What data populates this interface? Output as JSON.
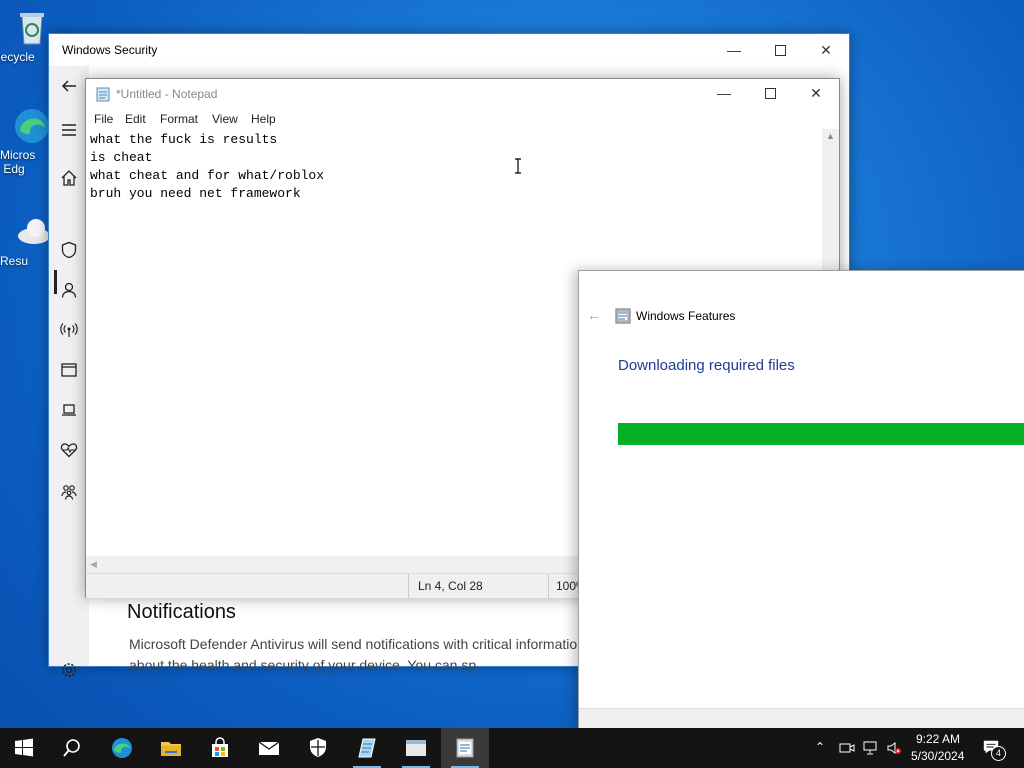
{
  "desktop": {
    "icons": [
      {
        "label": "Recycle",
        "icon": "recycle-bin-icon"
      },
      {
        "label": "Micros\nEdg",
        "icon": "edge-icon"
      },
      {
        "label": "Resu",
        "icon": "cloud-icon"
      }
    ]
  },
  "security_window": {
    "title": "Windows Security",
    "notifications_heading": "Notifications",
    "notifications_text": "Microsoft Defender Antivirus will send notifications with critical information about the health and security of your device. You can sp",
    "rail_icons": [
      "back-arrow-icon",
      "menu-icon",
      "home-icon",
      "shield-icon",
      "person-icon",
      "wireless-icon",
      "app-browser-icon",
      "laptop-icon",
      "heart-icon",
      "family-icon",
      "settings-icon"
    ]
  },
  "notepad": {
    "title": "*Untitled - Notepad",
    "menu": [
      "File",
      "Edit",
      "Format",
      "View",
      "Help"
    ],
    "lines": [
      "what the fuck is results",
      "is cheat",
      "what cheat and for what/roblox",
      "bruh you need net framework"
    ],
    "status_position": "Ln 4, Col 28",
    "status_zoom": "100%"
  },
  "features_window": {
    "title": "Windows Features",
    "heading": "Downloading required files",
    "progress_percent": 100
  },
  "taskbar": {
    "apps": [
      "start-icon",
      "search-icon",
      "edge-icon",
      "file-explorer-icon",
      "store-icon",
      "mail-icon",
      "security-shield-icon",
      "notepad-icon",
      "window-icon",
      "features-icon"
    ],
    "time": "9:22 AM",
    "date": "5/30/2024",
    "notification_count": "4"
  },
  "colors": {
    "accent_green": "#06b025",
    "heading_blue": "#1e3d8f",
    "taskbar": "#141414"
  }
}
